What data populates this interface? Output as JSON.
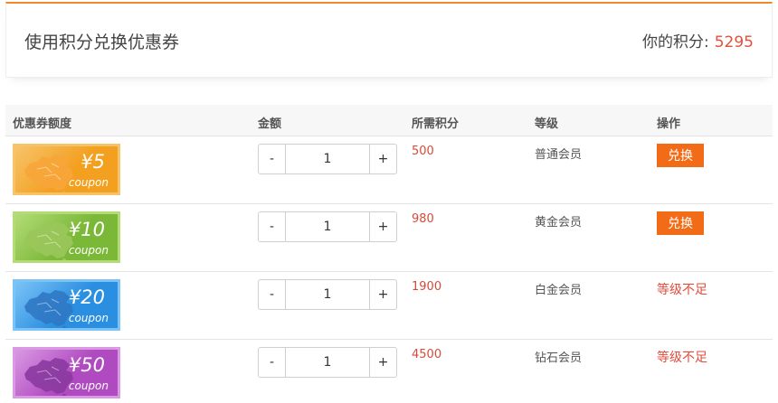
{
  "header": {
    "title": "使用积分兑换优惠券",
    "points_label": "你的积分:",
    "points_value": "5295"
  },
  "table": {
    "columns": [
      "优惠券额度",
      "金额",
      "所需积分",
      "等级",
      "操作"
    ],
    "rows": [
      {
        "coupon_amount": "¥5",
        "coupon_word": "coupon",
        "coupon_color": "#f3a020",
        "coupon_border": "#f7c36a",
        "map_color": "#f7a53a",
        "quantity": "1",
        "points": "500",
        "level": "普通会员",
        "action": "兑换",
        "action_type": "button"
      },
      {
        "coupon_amount": "¥10",
        "coupon_word": "coupon",
        "coupon_color": "#7cb838",
        "coupon_border": "#b3dc77",
        "map_color": "#9ac75b",
        "quantity": "1",
        "points": "980",
        "level": "黄金会员",
        "action": "兑换",
        "action_type": "button"
      },
      {
        "coupon_amount": "¥20",
        "coupon_word": "coupon",
        "coupon_color": "#2a8fe0",
        "coupon_border": "#7cc3f7",
        "map_color": "#3078c4",
        "quantity": "1",
        "points": "1900",
        "level": "白金会员",
        "action": "等级不足",
        "action_type": "text"
      },
      {
        "coupon_amount": "¥50",
        "coupon_word": "coupon",
        "coupon_color": "#b04ac0",
        "coupon_border": "#d999e3",
        "map_color": "#8a3aa0",
        "quantity": "1",
        "points": "4500",
        "level": "钻石会员",
        "action": "等级不足",
        "action_type": "text"
      }
    ]
  },
  "stepper": {
    "minus": "-",
    "plus": "+"
  },
  "icons": {
    "coupon_map": "china-map-icon"
  }
}
